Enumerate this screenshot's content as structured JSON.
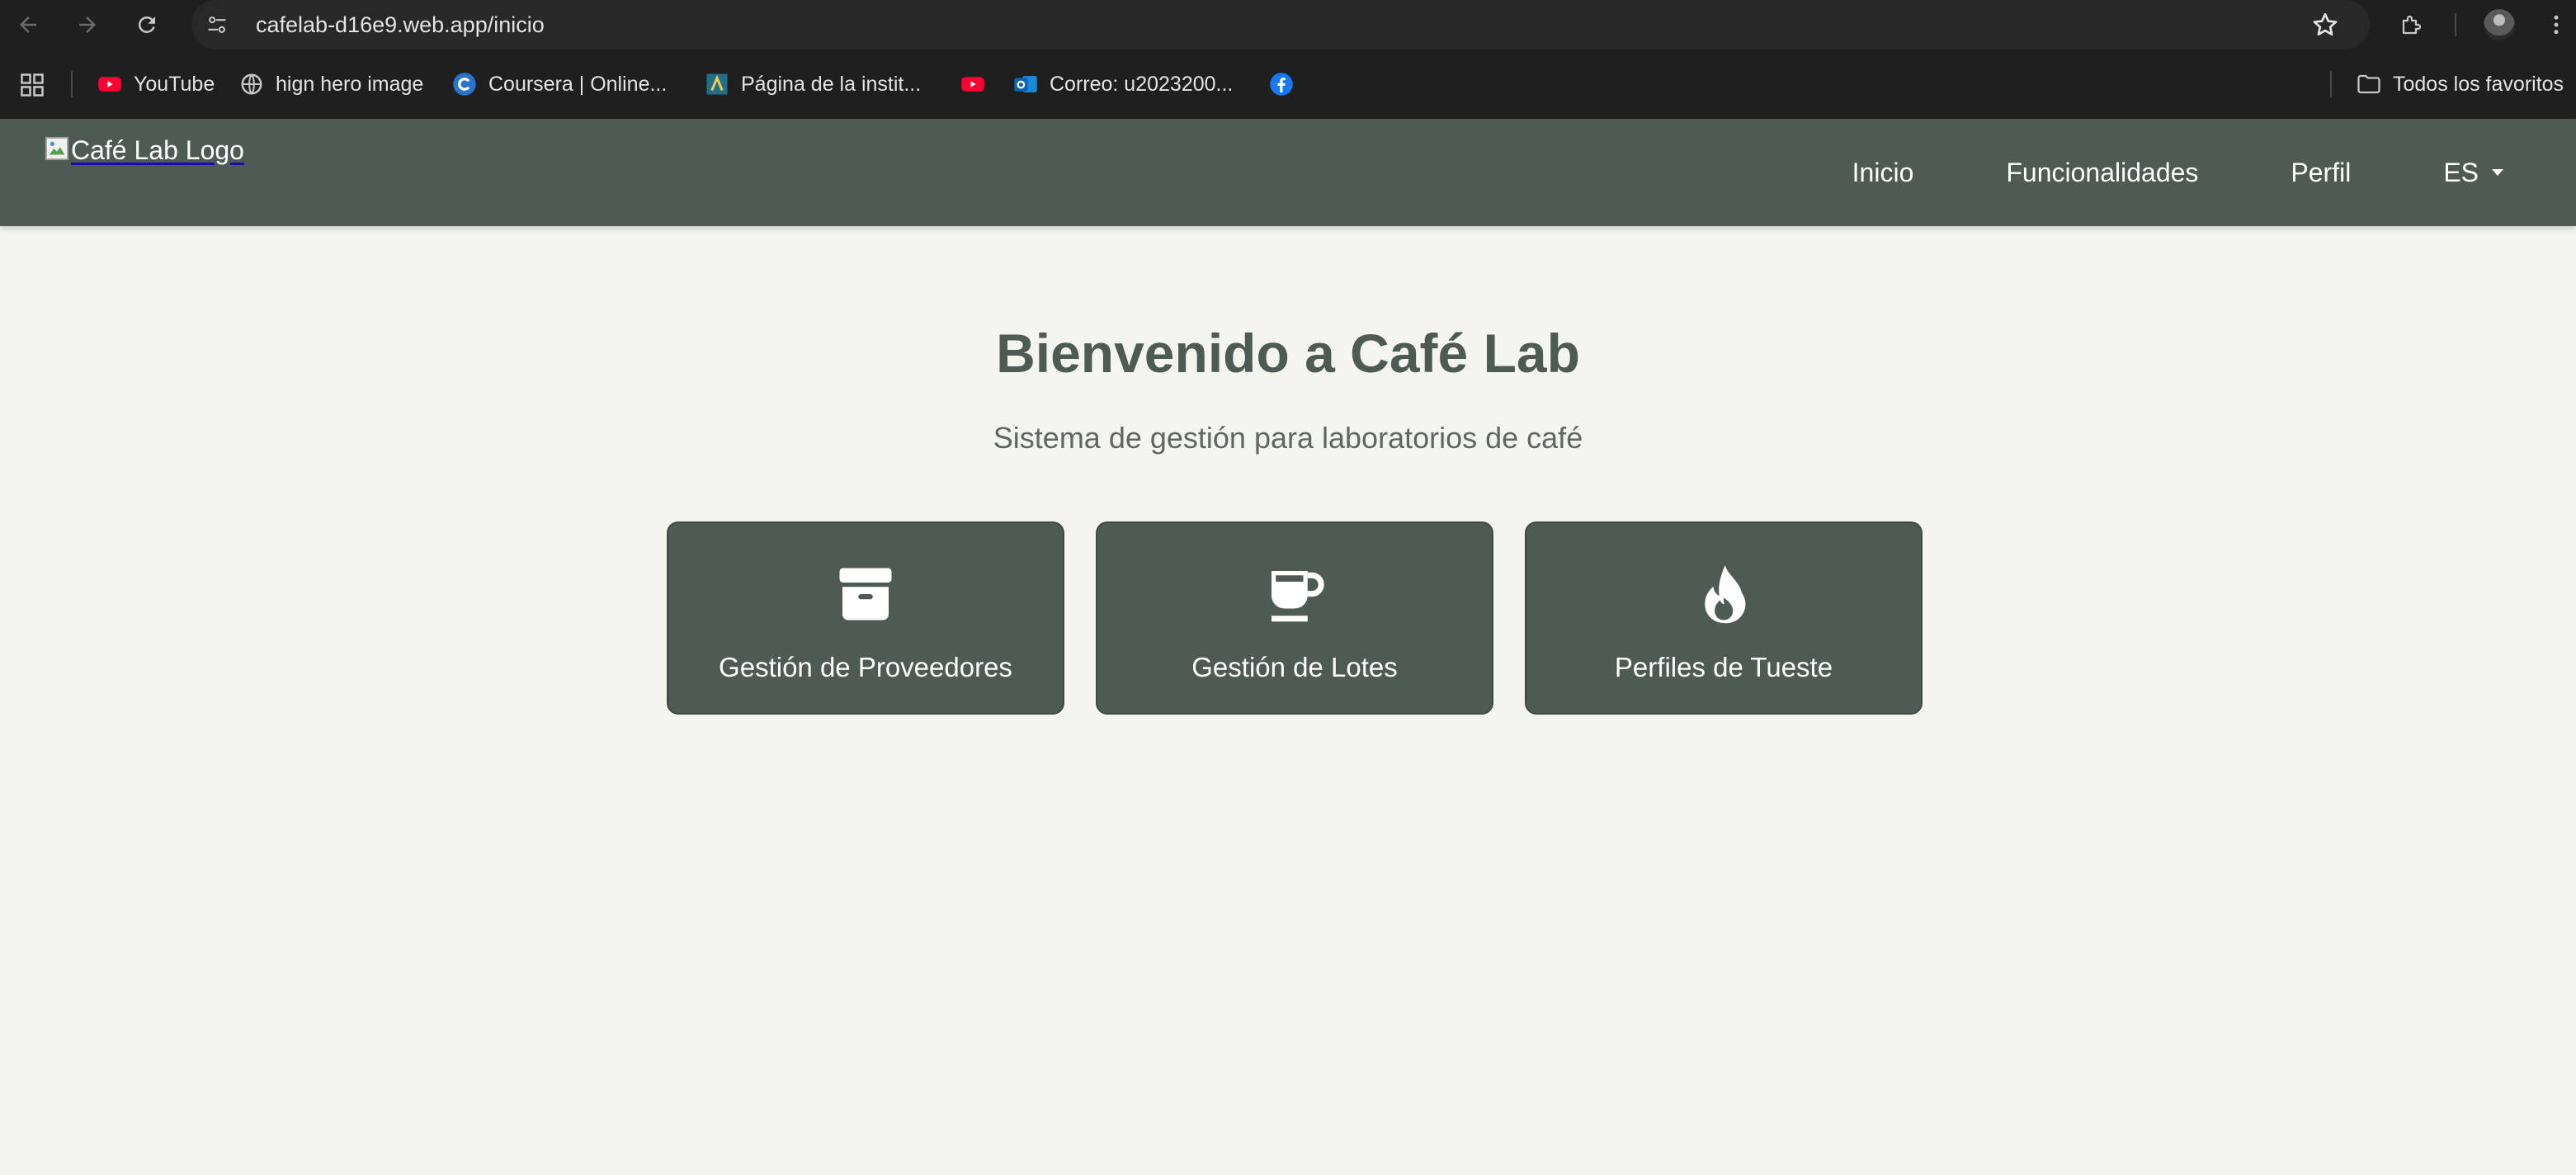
{
  "browser": {
    "url": "cafelab-d16e9.web.app/inicio",
    "bookmarks": [
      {
        "label": "YouTube",
        "icon": "youtube-icon"
      },
      {
        "label": "hign hero image",
        "icon": "globe-icon"
      },
      {
        "label": "Coursera | Online...",
        "icon": "coursera-icon"
      },
      {
        "label": "Página de la instit...",
        "icon": "institution-icon"
      },
      {
        "label": "",
        "icon": "youtube-icon"
      },
      {
        "label": "Correo: u2023200...",
        "icon": "outlook-icon"
      },
      {
        "label": "",
        "icon": "facebook-icon"
      }
    ],
    "all_bookmarks_label": "Todos los favoritos"
  },
  "app": {
    "logo_alt": "Café Lab Logo",
    "nav": {
      "home": "Inicio",
      "features": "Funcionalidades",
      "profile": "Perfil",
      "language": "ES"
    }
  },
  "hero": {
    "title": "Bienvenido a Café Lab",
    "subtitle": "Sistema de gestión para laboratorios de café"
  },
  "cards": [
    {
      "label": "Gestión de Proveedores",
      "icon": "archive-box-icon"
    },
    {
      "label": "Gestión de Lotes",
      "icon": "coffee-cup-icon"
    },
    {
      "label": "Perfiles de Tueste",
      "icon": "flame-icon"
    }
  ],
  "colors": {
    "header_bg": "#4e5b55",
    "page_bg": "#f5f5f0",
    "card_bg": "#4e5b55",
    "title_color": "#4e5b55"
  }
}
